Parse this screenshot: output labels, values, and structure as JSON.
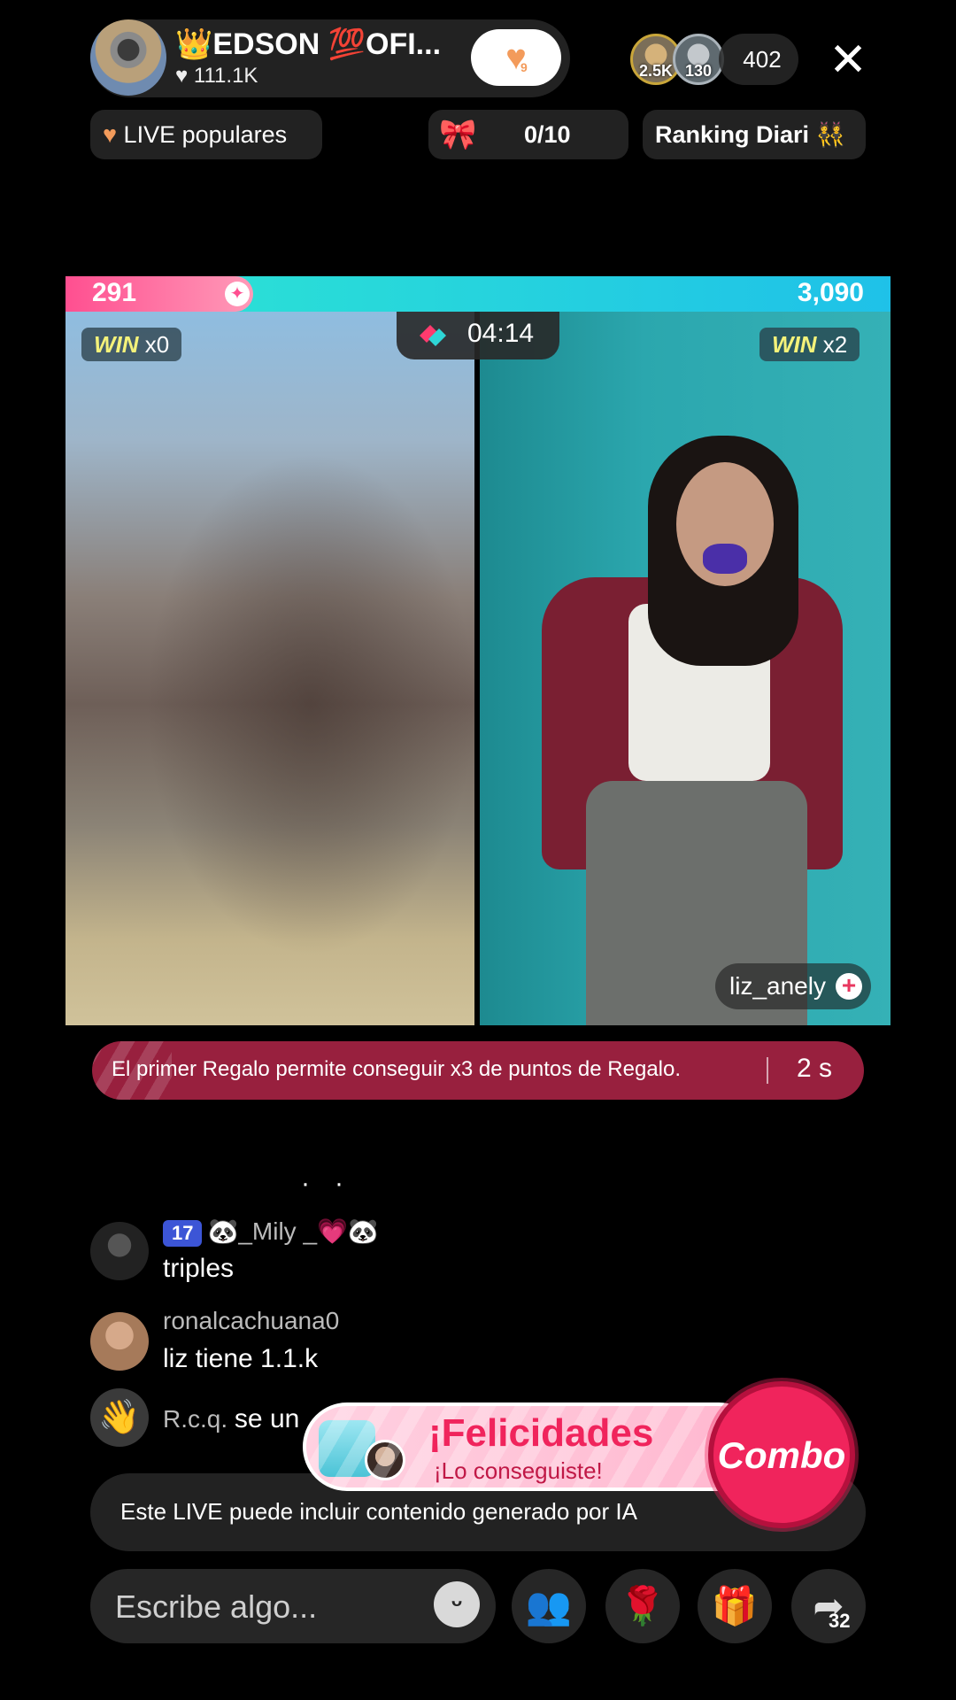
{
  "host": {
    "name": "👑EDSON 💯OFI...",
    "likes": "111.1K",
    "follow_count": "9"
  },
  "viewers": {
    "top1_badge": "2.5K",
    "top2_badge": "130",
    "count": "402"
  },
  "chips": {
    "live_popular": "LIVE populares",
    "goal": "0/10",
    "ranking": "Ranking Diari"
  },
  "battle": {
    "left_score": "291",
    "right_score": "3,090",
    "timer": "04:14",
    "left_win_word": "WIN",
    "left_win_count": "x0",
    "right_win_word": "WIN",
    "right_win_count": "x2",
    "opponent_name": "liz_anely"
  },
  "banner": {
    "text": "El primer Regalo permite conseguir x3 de puntos de Regalo.",
    "time": "2 s"
  },
  "chat": {
    "messages": [
      {
        "badge": "17",
        "user": "🐼_Mily _💗🐼",
        "text": "triples"
      },
      {
        "user": "ronalcachuana0",
        "text": "liz tiene 1.1.k"
      },
      {
        "user": "R.c.q.",
        "text": "se un"
      }
    ]
  },
  "notice": "Este LIVE puede incluir contenido generado por IA",
  "congrats": {
    "title": "¡Felicidades",
    "subtitle": "¡Lo conseguiste!",
    "combo": "Combo"
  },
  "bottom": {
    "placeholder": "Escribe algo...",
    "share_count": "32"
  },
  "colors": {
    "accent_pink": "#f0245c",
    "score_left": "#ff4f90",
    "score_right": "#1fc1e8",
    "banner": "#98203e"
  }
}
